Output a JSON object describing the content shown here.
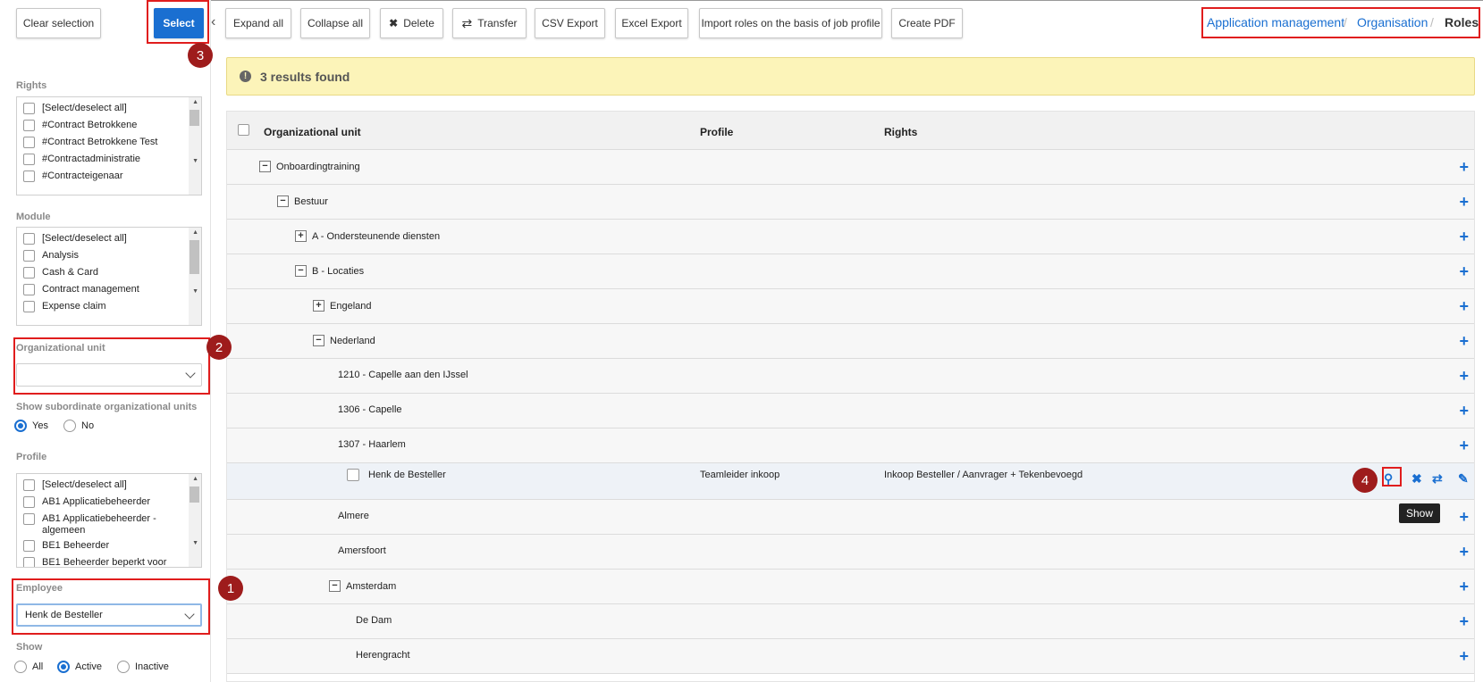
{
  "toolbar": {
    "clear_selection": "Clear selection",
    "select": "Select",
    "expand_all": "Expand all",
    "collapse_all": "Collapse all",
    "delete": "Delete",
    "transfer": "Transfer",
    "csv_export": "CSV Export",
    "excel_export": "Excel Export",
    "import_roles": "Import roles on the basis of job profile",
    "create_pdf": "Create PDF"
  },
  "breadcrumb": {
    "items": [
      "Application management",
      "Organisation",
      "Roles"
    ],
    "separator": "/"
  },
  "badges": [
    "1",
    "2",
    "3",
    "4"
  ],
  "sidebar": {
    "rights": {
      "label": "Rights",
      "items": [
        "[Select/deselect all]",
        "#Contract Betrokkene",
        "#Contract Betrokkene Test",
        "#Contractadministratie",
        "#Contracteigenaar"
      ]
    },
    "module": {
      "label": "Module",
      "items": [
        "[Select/deselect all]",
        "Analysis",
        "Cash & Card",
        "Contract management",
        "Expense claim"
      ]
    },
    "org_unit": {
      "label": "Organizational unit",
      "value": ""
    },
    "subordinate": {
      "label": "Show subordinate organizational units",
      "options": [
        "Yes",
        "No"
      ],
      "selected": "Yes"
    },
    "profile": {
      "label": "Profile",
      "items": [
        "[Select/deselect all]",
        "AB1 Applicatiebeheerder",
        "AB1 Applicatiebeheerder - algemeen",
        "BE1 Beheerder",
        "BE1 Beheerder beperkt voor"
      ]
    },
    "employee": {
      "label": "Employee",
      "value": "Henk de Besteller"
    },
    "show": {
      "label": "Show",
      "options": [
        "All",
        "Active",
        "Inactive"
      ],
      "selected": "Active"
    }
  },
  "alert": {
    "text": "3 results found"
  },
  "table": {
    "columns": [
      "Organizational unit",
      "Profile",
      "Rights"
    ],
    "rows": [
      {
        "label": "Onboardingtraining",
        "toggle": "−"
      },
      {
        "label": "Bestuur",
        "toggle": "−"
      },
      {
        "label": "A - Ondersteunende diensten",
        "toggle": "+"
      },
      {
        "label": "B - Locaties",
        "toggle": "−"
      },
      {
        "label": "Engeland",
        "toggle": "+"
      },
      {
        "label": "Nederland",
        "toggle": "−"
      },
      {
        "label": "1210 - Capelle aan den IJssel",
        "toggle": ""
      },
      {
        "label": "1306 - Capelle",
        "toggle": ""
      },
      {
        "label": "1307 - Haarlem",
        "toggle": ""
      },
      {
        "label": "Henk de Besteller",
        "toggle": "",
        "profile": "Teamleider inkoop",
        "rights": "Inkoop Besteller / Aanvrager + Tekenbevoegd"
      },
      {
        "label": "Almere",
        "toggle": ""
      },
      {
        "label": "Amersfoort",
        "toggle": ""
      },
      {
        "label": "Amsterdam",
        "toggle": "−"
      },
      {
        "label": "De Dam",
        "toggle": ""
      },
      {
        "label": "Herengracht",
        "toggle": ""
      }
    ]
  },
  "tooltip": "Show",
  "colors": {
    "primary": "#1a6fd1",
    "highlight": "#e01d1d",
    "badge": "#9e1c1c",
    "alert_bg": "#fcf4b9"
  }
}
